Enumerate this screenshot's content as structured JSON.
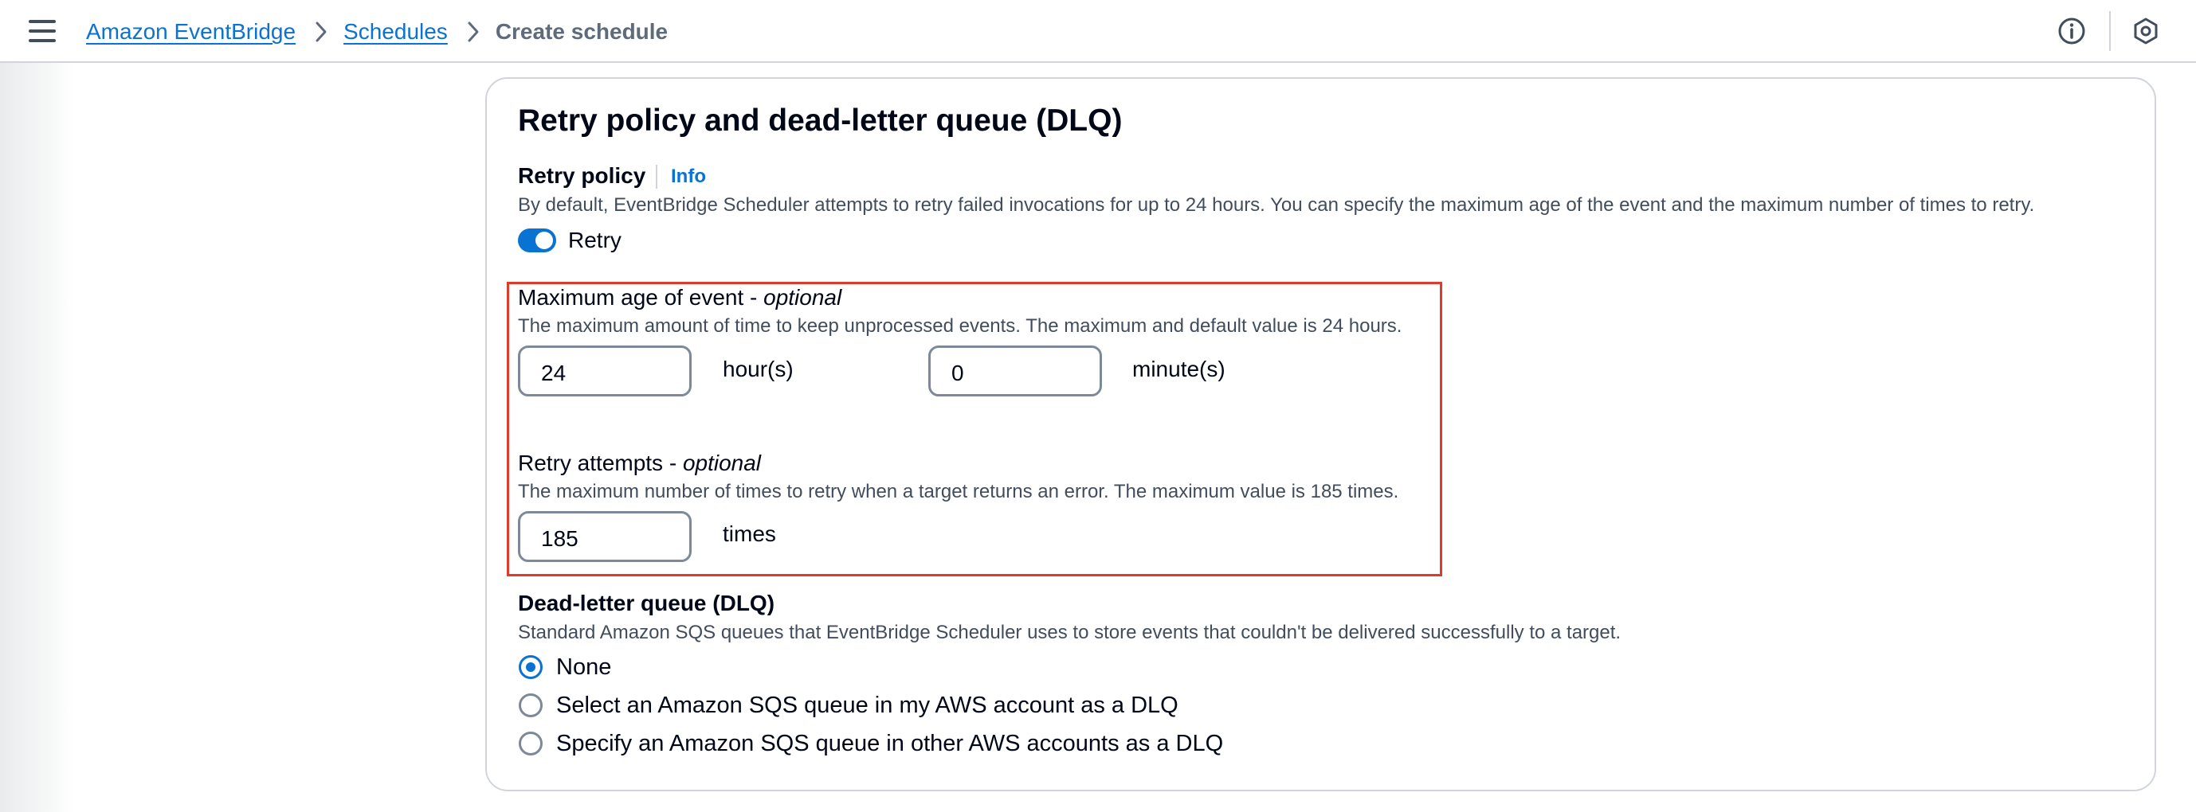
{
  "breadcrumb": {
    "items": [
      "Amazon EventBridge",
      "Schedules"
    ],
    "current": "Create schedule"
  },
  "section": {
    "title": "Retry policy and dead-letter queue (DLQ)"
  },
  "retry_policy": {
    "label": "Retry policy",
    "info": "Info",
    "description": "By default, EventBridge Scheduler attempts to retry failed invocations for up to 24 hours. You can specify the maximum age of the event and the maximum number of times to retry.",
    "toggle_label": "Retry",
    "toggle_on": true
  },
  "max_age": {
    "label": "Maximum age of event - ",
    "optional": "optional",
    "description": "The maximum amount of time to keep unprocessed events. The maximum and default value is 24 hours.",
    "hours_value": "24",
    "hours_unit": "hour(s)",
    "minutes_value": "0",
    "minutes_unit": "minute(s)"
  },
  "retry_attempts": {
    "label": "Retry attempts - ",
    "optional": "optional",
    "description": "The maximum number of times to retry when a target returns an error. The maximum value is 185 times.",
    "value": "185",
    "unit": "times"
  },
  "dlq": {
    "label": "Dead-letter queue (DLQ)",
    "description": "Standard Amazon SQS queues that EventBridge Scheduler uses to store events that couldn't be delivered successfully to a target.",
    "options": [
      {
        "label": "None",
        "selected": true
      },
      {
        "label": "Select an Amazon SQS queue in my AWS account as a DLQ",
        "selected": false
      },
      {
        "label": "Specify an Amazon SQS queue in other AWS accounts as a DLQ",
        "selected": false
      }
    ]
  },
  "colors": {
    "accent": "#0972d3",
    "highlight_border": "#e03a2a",
    "text": "#000716",
    "muted_text": "#414d5c"
  },
  "icons": [
    "menu-icon",
    "chevron-right-icon",
    "info-circle-icon",
    "settings-hexagon-icon"
  ]
}
